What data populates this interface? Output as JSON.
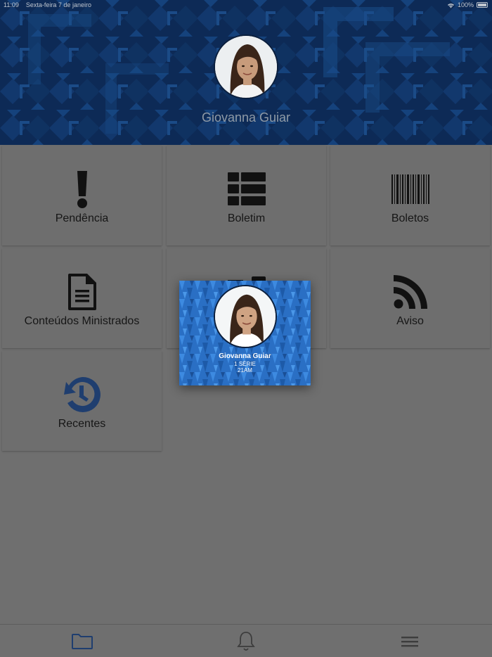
{
  "status_bar": {
    "time": "11:09",
    "date": "Sexta-feira 7 de janeiro",
    "battery": "100%"
  },
  "profile": {
    "name": "Giovanna Guiar"
  },
  "tiles": [
    {
      "label": "Pendência",
      "icon": "exclamation-icon"
    },
    {
      "label": "Boletim",
      "icon": "grid-table-icon"
    },
    {
      "label": "Boletos",
      "icon": "barcode-icon"
    },
    {
      "label": "Conteúdos Ministrados",
      "icon": "document-icon"
    },
    {
      "label": "",
      "icon": "id-card-icon"
    },
    {
      "label": "Aviso",
      "icon": "rss-feed-icon"
    },
    {
      "label": "Recentes",
      "icon": "history-icon"
    }
  ],
  "student_card": {
    "name": "Giovanna Guiar",
    "grade": "1 SÉRIE",
    "class": "21AM"
  },
  "bottom_nav": [
    {
      "name": "folder",
      "icon": "folder-icon"
    },
    {
      "name": "notifications",
      "icon": "bell-icon"
    },
    {
      "name": "menu",
      "icon": "hamburger-menu-icon"
    }
  ],
  "colors": {
    "header_bg": "#0d2a56",
    "history_icon": "#1f3e6f",
    "overlay_tile": "#6e6e6e",
    "card_bg": "#2a6fc4"
  }
}
